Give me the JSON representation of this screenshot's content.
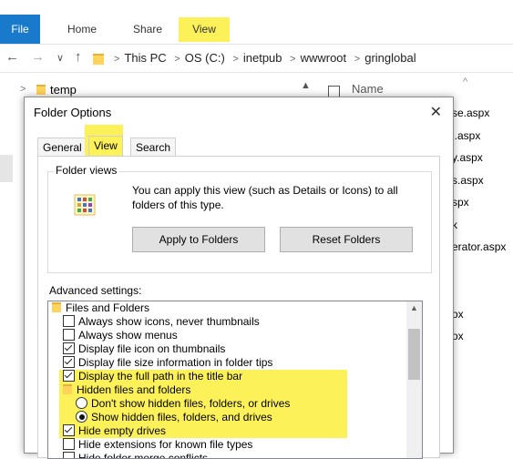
{
  "ribbon": {
    "file": "File",
    "home": "Home",
    "share": "Share",
    "view": "View"
  },
  "address": {
    "back": "←",
    "forward": "→",
    "down": "∨",
    "up": "↑",
    "crumbs": [
      "This PC",
      "OS (C:)",
      "inetpub",
      "wwwroot",
      "gringlobal"
    ]
  },
  "background": {
    "tree_item": "temp",
    "column_name": "Name",
    "files": [
      "se.aspx",
      "l.aspx",
      "y.aspx",
      "s.aspx",
      "spx",
      "k",
      "erator.aspx",
      "",
      "",
      "ox",
      "ox"
    ]
  },
  "dialog": {
    "title": "Folder Options",
    "close": "✕",
    "tabs": [
      "General",
      "View",
      "Search"
    ],
    "folder_views": {
      "label": "Folder views",
      "text": "You can apply this view (such as Details or Icons) to all folders of this type.",
      "apply_button": "Apply to Folders",
      "reset_button": "Reset Folders"
    },
    "advanced_label": "Advanced settings:",
    "settings": [
      {
        "type": "folder",
        "label": "Files and Folders",
        "indent": 0
      },
      {
        "type": "checkbox",
        "checked": false,
        "label": "Always show icons, never thumbnails",
        "indent": 1
      },
      {
        "type": "checkbox",
        "checked": false,
        "label": "Always show menus",
        "indent": 1
      },
      {
        "type": "checkbox",
        "checked": true,
        "label": "Display file icon on thumbnails",
        "indent": 1
      },
      {
        "type": "checkbox",
        "checked": true,
        "label": "Display file size information in folder tips",
        "indent": 1
      },
      {
        "type": "checkbox",
        "checked": true,
        "label": "Display the full path in the title bar",
        "indent": 1,
        "highlight": true
      },
      {
        "type": "folder",
        "label": "Hidden files and folders",
        "indent": 1,
        "highlight": true
      },
      {
        "type": "radio",
        "checked": false,
        "label": "Don't show hidden files, folders, or drives",
        "indent": 2,
        "highlight": true
      },
      {
        "type": "radio",
        "checked": true,
        "label": "Show hidden files, folders, and drives",
        "indent": 2,
        "highlight": true
      },
      {
        "type": "checkbox",
        "checked": true,
        "label": "Hide empty drives",
        "indent": 1,
        "highlight": true
      },
      {
        "type": "checkbox",
        "checked": false,
        "label": "Hide extensions for known file types",
        "indent": 1
      },
      {
        "type": "checkbox",
        "checked": false,
        "label": "Hide folder merge conflicts",
        "indent": 1
      }
    ]
  },
  "colors": {
    "highlight": "#fdf15a",
    "file_tab": "#1979ca"
  }
}
